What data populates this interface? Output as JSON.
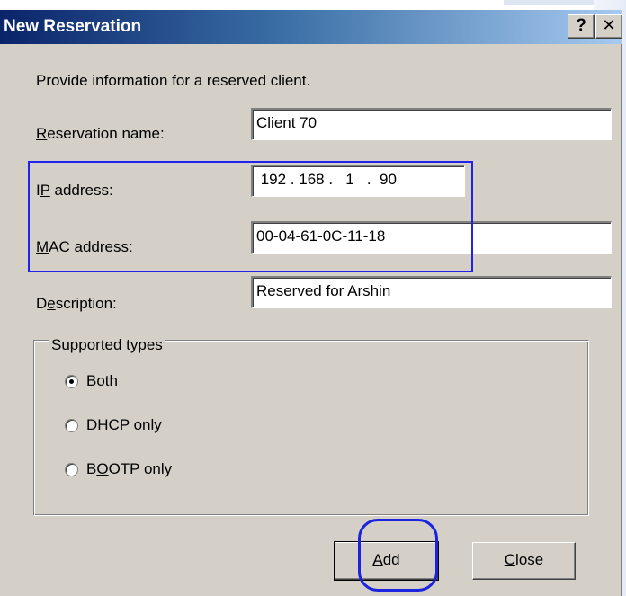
{
  "window": {
    "title": "New Reservation",
    "help_label": "?",
    "close_label": "✕"
  },
  "intro": "Provide information for a reserved client.",
  "fields": {
    "reservation_name": {
      "label_key": "R",
      "label_rest": "eservation name:",
      "value": "Client 70"
    },
    "ip_address": {
      "label_pre": "I",
      "label_key": "P",
      "label_rest": " address:",
      "value": " 192 . 168 .   1   .  90"
    },
    "mac_address": {
      "label_key": "M",
      "label_rest": "AC address:",
      "value": "00-04-61-0C-11-18"
    },
    "description": {
      "label_pre": "D",
      "label_key": "e",
      "label_rest": "scription:",
      "value": "Reserved for Arshin"
    }
  },
  "supported_types": {
    "legend": "Supported types",
    "options": [
      {
        "key": "B",
        "rest": "oth",
        "pre": "",
        "selected": true
      },
      {
        "key": "D",
        "rest": "HCP only",
        "pre": "",
        "selected": false
      },
      {
        "key": "O",
        "rest": "OTP only",
        "pre": "B",
        "selected": false
      }
    ]
  },
  "buttons": {
    "add": {
      "key": "A",
      "rest": "dd"
    },
    "close": {
      "key": "C",
      "rest": "lose"
    }
  },
  "colors": {
    "annotation": "#2222ee",
    "dialog_face": "#d4d0c8",
    "title_bar": "#0a246a"
  }
}
